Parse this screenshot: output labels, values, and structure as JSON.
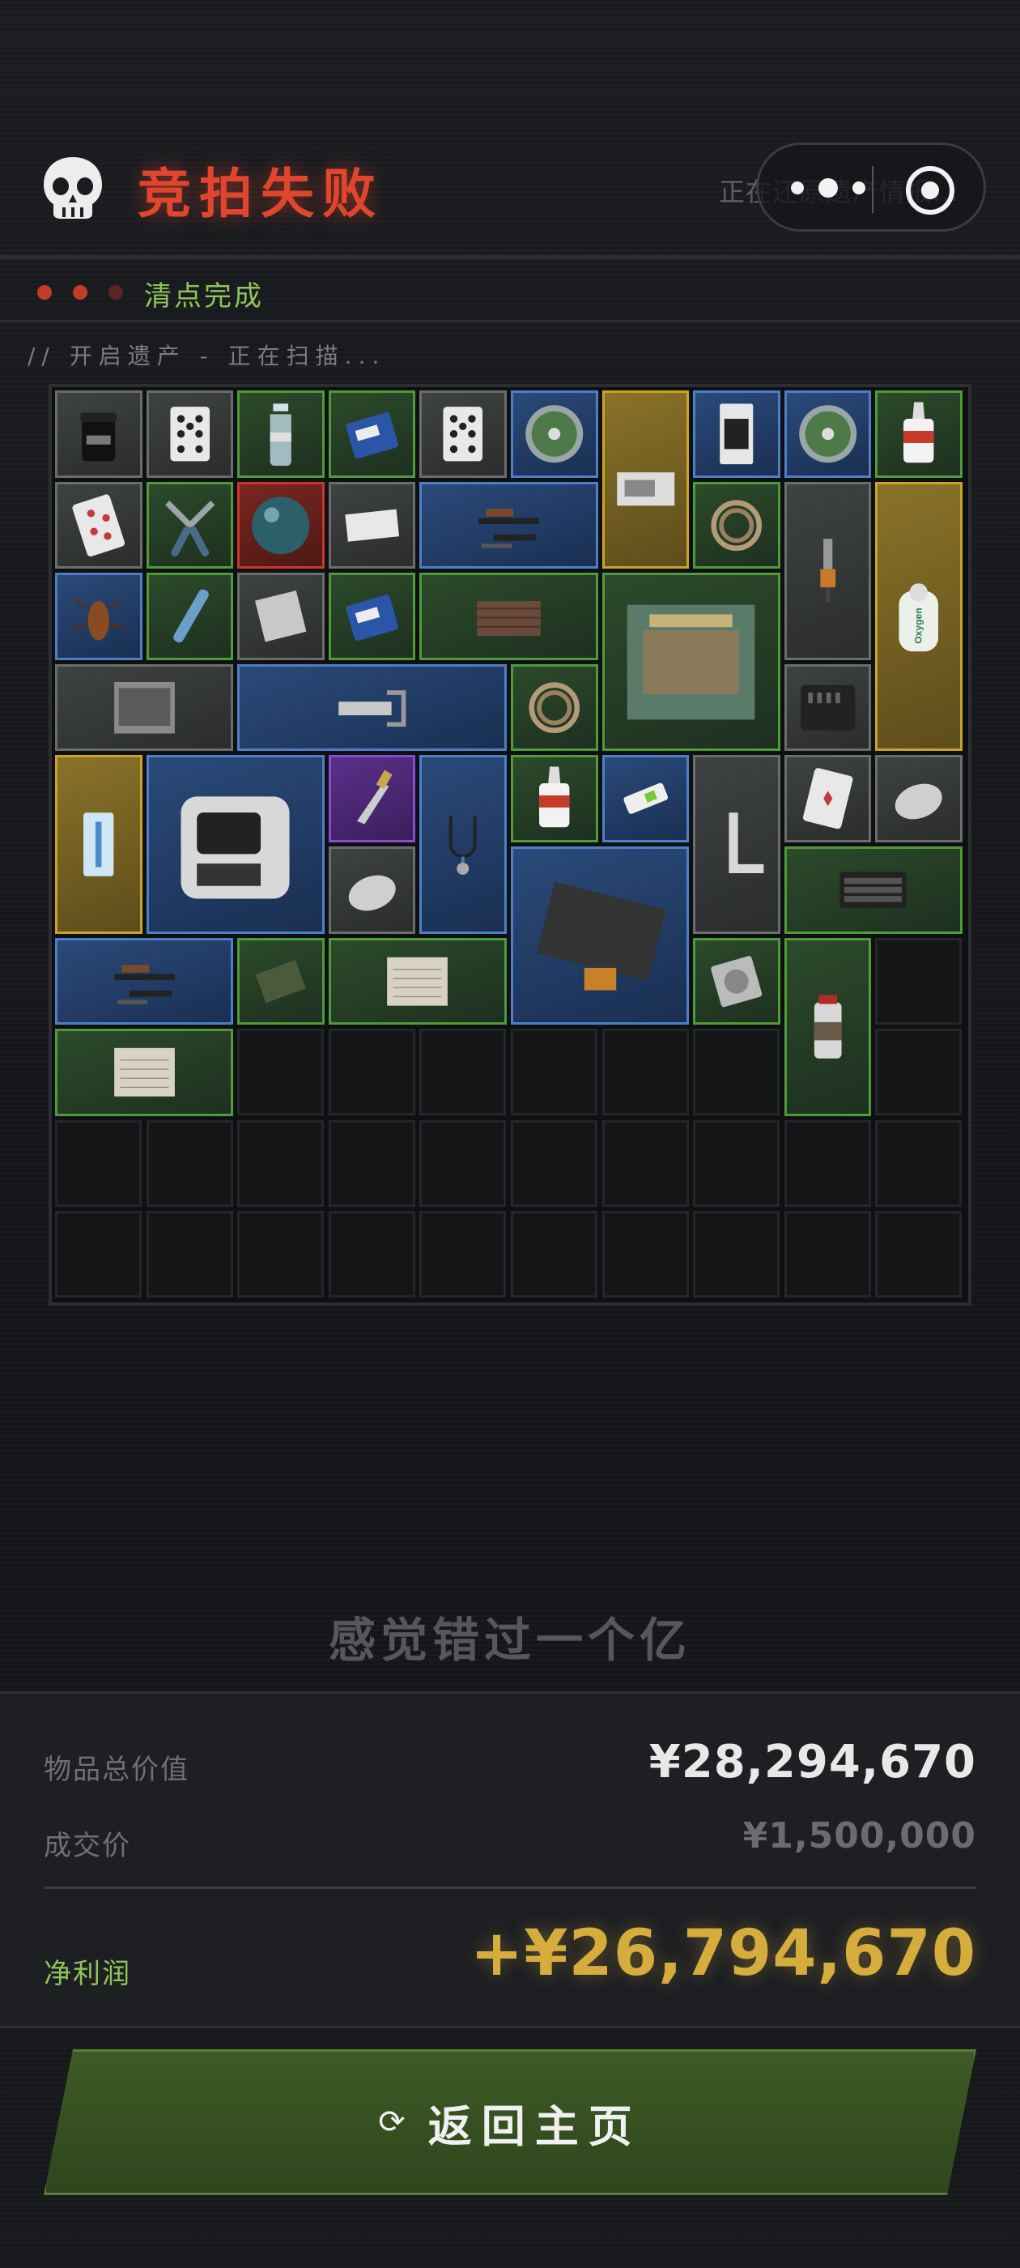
{
  "header": {
    "title": "竞拍失败",
    "ghost_text": "正在还原遗产情报...",
    "skull_icon": "skull-icon",
    "capsule": {
      "more_icon": "more-dots-icon",
      "close_icon": "target-close-icon"
    }
  },
  "status": {
    "text": "清点完成",
    "dot_colors": [
      "#c43b2e",
      "#c43b2e",
      "#5a2420"
    ]
  },
  "scan": {
    "text": "// 开启遗产 - 正在扫描..."
  },
  "inventory": {
    "columns": 10,
    "rows": 10,
    "items": [
      {
        "name": "supplement-jar",
        "rarity": "gray"
      },
      {
        "name": "playing-card-spades",
        "rarity": "gray"
      },
      {
        "name": "water-bottle",
        "rarity": "green"
      },
      {
        "name": "battery-9v",
        "rarity": "green"
      },
      {
        "name": "playing-card-spades",
        "rarity": "gray"
      },
      {
        "name": "dvd-disc",
        "rarity": "blue"
      },
      {
        "name": "photo-document",
        "rarity": "gold"
      },
      {
        "name": "memory-card-pack",
        "rarity": "blue"
      },
      {
        "name": "dvd-disc",
        "rarity": "blue"
      },
      {
        "name": "glue-bottle",
        "rarity": "green"
      },
      {
        "name": "playing-card-hearts",
        "rarity": "gray"
      },
      {
        "name": "pliers",
        "rarity": "green"
      },
      {
        "name": "marble-sphere",
        "rarity": "red"
      },
      {
        "name": "napkin",
        "rarity": "gray"
      },
      {
        "name": "disassembled-rifle",
        "rarity": "blue"
      },
      {
        "name": "hose-coil",
        "rarity": "green"
      },
      {
        "name": "screwdriver-tool",
        "rarity": "gray"
      },
      {
        "name": "oxygen-tank",
        "rarity": "gold",
        "label": "Oxygen"
      },
      {
        "name": "cockroach",
        "rarity": "blue"
      },
      {
        "name": "pen-thermometer",
        "rarity": "green"
      },
      {
        "name": "paper-sheet",
        "rarity": "gray"
      },
      {
        "name": "battery-9v",
        "rarity": "green"
      },
      {
        "name": "wood-plank",
        "rarity": "green"
      },
      {
        "name": "hotel-painting",
        "rarity": "green"
      },
      {
        "name": "old-photograph",
        "rarity": "gray"
      },
      {
        "name": "hacksaw",
        "rarity": "blue"
      },
      {
        "name": "hose-coil",
        "rarity": "green"
      },
      {
        "name": "bit-set-case",
        "rarity": "gray"
      },
      {
        "name": "syringe-pack",
        "rarity": "gold"
      },
      {
        "name": "smart-device",
        "rarity": "blue"
      },
      {
        "name": "ornate-knife",
        "rarity": "purple"
      },
      {
        "name": "stethoscope",
        "rarity": "blue"
      },
      {
        "name": "glue-bottle",
        "rarity": "green"
      },
      {
        "name": "usb-stick",
        "rarity": "blue"
      },
      {
        "name": "carpenter-square",
        "rarity": "gray"
      },
      {
        "name": "playing-card-diamonds",
        "rarity": "gray"
      },
      {
        "name": "computer-mouse",
        "rarity": "gray"
      },
      {
        "name": "computer-mouse",
        "rarity": "gray"
      },
      {
        "name": "lcd-panel",
        "rarity": "blue"
      },
      {
        "name": "keyboard",
        "rarity": "green"
      },
      {
        "name": "disassembled-rifle",
        "rarity": "blue"
      },
      {
        "name": "ration-pack",
        "rarity": "green"
      },
      {
        "name": "old-manuscript",
        "rarity": "green"
      },
      {
        "name": "hard-drive",
        "rarity": "green"
      },
      {
        "name": "spray-can",
        "rarity": "green"
      },
      {
        "name": "old-manuscript",
        "rarity": "green"
      }
    ]
  },
  "slogan": "感觉错过一个亿",
  "summary": {
    "total_label": "物品总价值",
    "total_value": "¥28,294,670",
    "deal_label": "成交价",
    "deal_value": "¥1,500,000",
    "profit_label": "净利润",
    "profit_value": "+¥26,794,670",
    "colors": {
      "profit": "#d6ad3c",
      "profit_label": "#8fc45a",
      "total": "#e8e8e8",
      "deal": "#6a6c70"
    }
  },
  "home_button": {
    "icon": "refresh-icon",
    "label": "返回主页"
  }
}
